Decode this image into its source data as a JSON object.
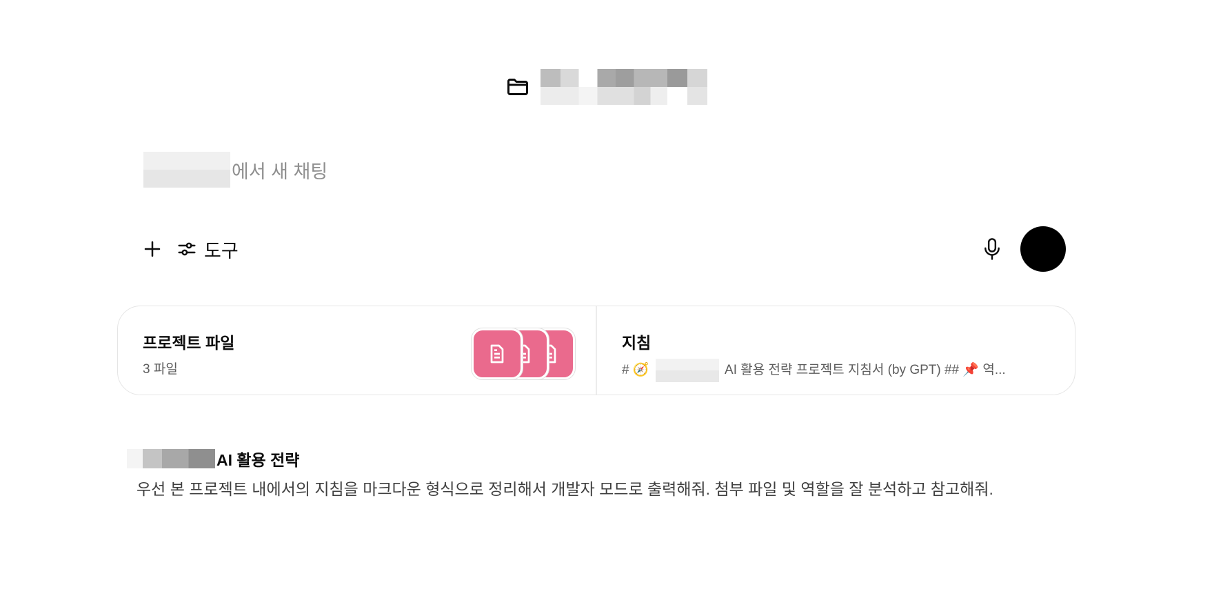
{
  "project": {
    "title": ""
  },
  "composer": {
    "placeholder_suffix": "에서 새 채팅",
    "tools_label": "도구"
  },
  "cards": {
    "files": {
      "title": "프로젝트 파일",
      "count_text": "3 파일"
    },
    "instructions": {
      "title": "지침",
      "preview_prefix": "# 🧭 ",
      "preview_suffix": " AI 활용 전략 프로젝트 지침서 (by GPT) ## 📌 역..."
    }
  },
  "chat": {
    "title_suffix": "AI 활용 전략",
    "description": "우선 본 프로젝트 내에서의 지침을 마크다운 형식으로 정리해서 개발자 모드로 출력해줘. 첨부 파일 및 역할을 잘 분석하고 참고해줘."
  },
  "colors": {
    "file_tile": "#ea6a8d",
    "send_button": "#000000"
  },
  "icons": [
    "folder-icon",
    "plus-icon",
    "sliders-icon",
    "mic-icon",
    "document-icon"
  ]
}
